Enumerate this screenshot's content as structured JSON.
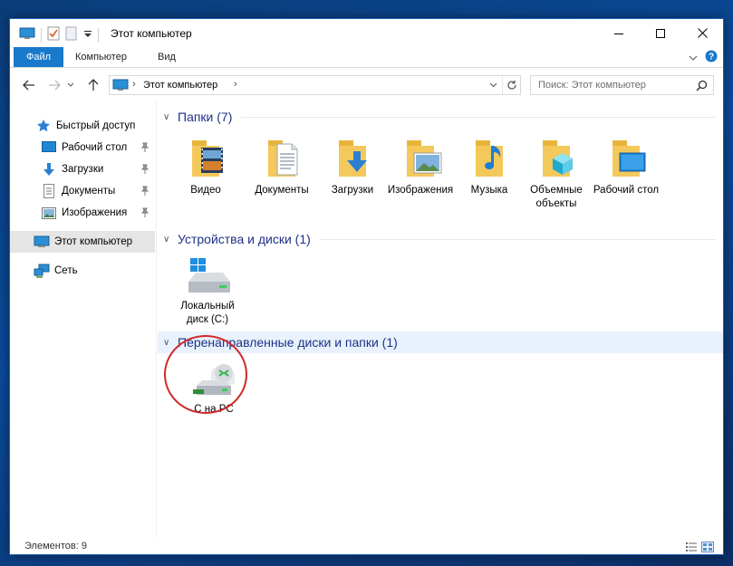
{
  "window": {
    "title": "Этот компьютер"
  },
  "ribbon": {
    "tabs": [
      "Файл",
      "Компьютер",
      "Вид"
    ]
  },
  "address": {
    "crumb": "Этот компьютер"
  },
  "search": {
    "placeholder": "Поиск: Этот компьютер"
  },
  "sidebar": {
    "items": [
      {
        "label": "Быстрый доступ",
        "icon": "star-icon"
      },
      {
        "label": "Рабочий стол",
        "icon": "desktop-icon",
        "pinned": true
      },
      {
        "label": "Загрузки",
        "icon": "download-icon",
        "pinned": true
      },
      {
        "label": "Документы",
        "icon": "document-icon",
        "pinned": true
      },
      {
        "label": "Изображения",
        "icon": "image-icon",
        "pinned": true
      },
      {
        "label": "Этот компьютер",
        "icon": "computer-icon",
        "selected": true
      },
      {
        "label": "Сеть",
        "icon": "network-icon"
      }
    ]
  },
  "groups": [
    {
      "title": "Папки (7)",
      "items": [
        {
          "label": "Видео",
          "icon": "video-folder-icon"
        },
        {
          "label": "Документы",
          "icon": "documents-folder-icon"
        },
        {
          "label": "Загрузки",
          "icon": "downloads-folder-icon"
        },
        {
          "label": "Изображения",
          "icon": "pictures-folder-icon"
        },
        {
          "label": "Музыка",
          "icon": "music-folder-icon"
        },
        {
          "label": "Объемные объекты",
          "icon": "3d-objects-folder-icon"
        },
        {
          "label": "Рабочий стол",
          "icon": "desktop-folder-icon"
        }
      ]
    },
    {
      "title": "Устройства и диски (1)",
      "items": [
        {
          "label": "Локальный диск (C:)",
          "icon": "local-disk-icon"
        }
      ]
    },
    {
      "title": "Перенаправленные диски и папки (1)",
      "items": [
        {
          "label": "C на PC",
          "icon": "redirected-drive-icon"
        }
      ]
    }
  ],
  "status": {
    "text": "Элементов: 9"
  },
  "colors": {
    "accent": "#1979ca",
    "group_title": "#1e3287",
    "highlight_circle": "#d1272a",
    "folder": "#f3c95c"
  }
}
